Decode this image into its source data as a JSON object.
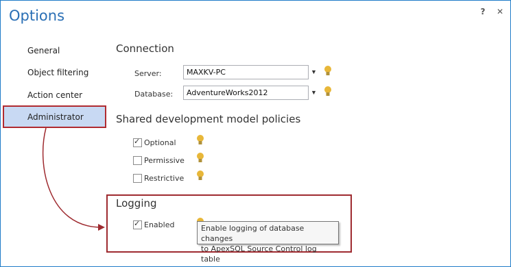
{
  "window": {
    "title": "Options",
    "help_label": "?",
    "close_label": "✕"
  },
  "sidebar": {
    "items": [
      {
        "label": "General"
      },
      {
        "label": "Object filtering"
      },
      {
        "label": "Action center"
      },
      {
        "label": "Administrator"
      }
    ],
    "selected": "Administrator"
  },
  "connection": {
    "heading": "Connection",
    "server_label": "Server:",
    "server_value": "MAXKV-PC",
    "database_label": "Database:",
    "database_value": "AdventureWorks2012"
  },
  "policies": {
    "heading": "Shared development model policies",
    "options": [
      {
        "label": "Optional",
        "checked": true
      },
      {
        "label": "Permissive",
        "checked": false
      },
      {
        "label": "Restrictive",
        "checked": false
      }
    ]
  },
  "logging": {
    "heading": "Logging",
    "enabled_label": "Enabled",
    "enabled_checked": true,
    "tooltip_line1": "Enable logging of database changes",
    "tooltip_line2": "to ApexSQL Source Control log table"
  },
  "colors": {
    "accent": "#2a6fb5",
    "selection_bg": "#c8d9f3",
    "highlight_border": "#9e2a2f",
    "bulb": "#e8b739"
  },
  "icons": {
    "hint": "lightbulb-icon",
    "dropdown": "dropdown-arrow-icon",
    "check": "checkmark-icon"
  }
}
